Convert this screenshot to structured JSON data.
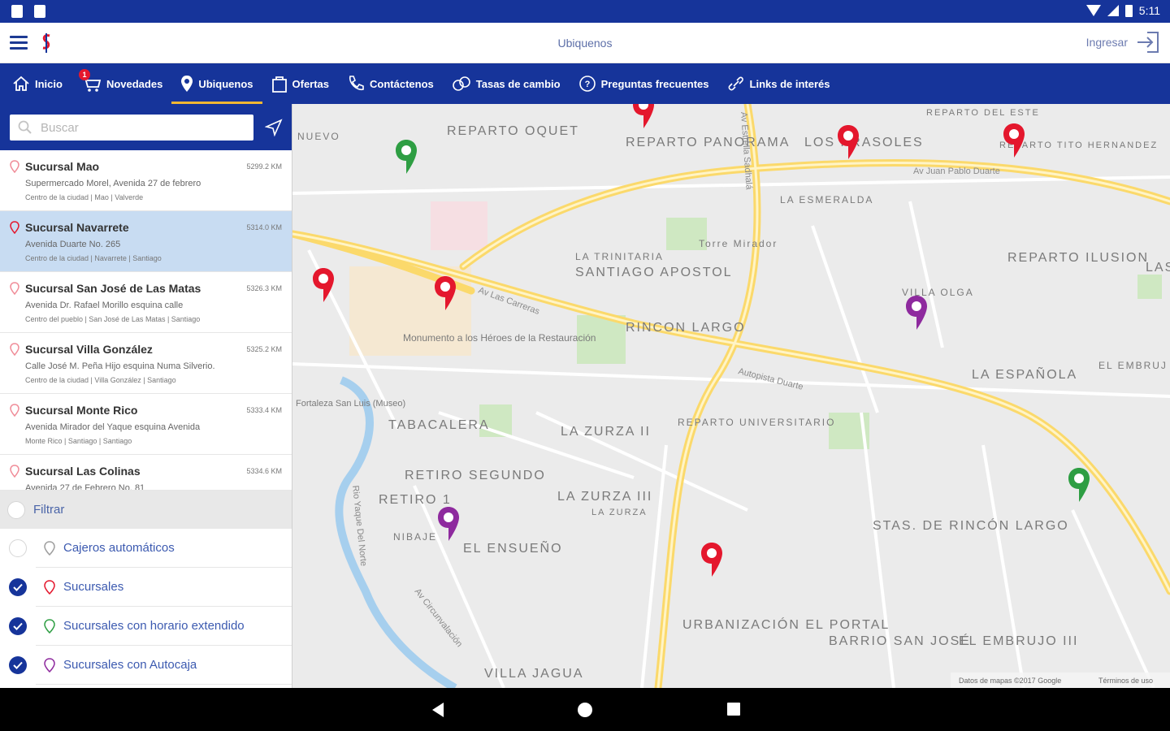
{
  "status_bar": {
    "time": "5:11"
  },
  "app_bar": {
    "title": "Ubiquenos",
    "login_label": "Ingresar"
  },
  "nav": {
    "tabs": [
      {
        "label": "Inicio",
        "icon": "home-icon"
      },
      {
        "label": "Novedades",
        "icon": "cart-icon",
        "badge": "1"
      },
      {
        "label": "Ubiquenos",
        "icon": "location-pin-icon",
        "active": true
      },
      {
        "label": "Ofertas",
        "icon": "offers-bag-icon"
      },
      {
        "label": "Contáctenos",
        "icon": "phone-icon"
      },
      {
        "label": "Tasas de cambio",
        "icon": "exchange-icon"
      },
      {
        "label": "Preguntas frecuentes",
        "icon": "question-icon"
      },
      {
        "label": "Links de interés",
        "icon": "link-icon"
      }
    ]
  },
  "search": {
    "placeholder": "Buscar"
  },
  "branches": [
    {
      "name": "Sucursal Mao",
      "distance": "5299.2 KM",
      "address": "Supermercado Morel, Avenida 27 de febrero",
      "zone": "Centro de la ciudad | Mao | Valverde"
    },
    {
      "name": "Sucursal Navarrete",
      "distance": "5314.0 KM",
      "address": "Avenida Duarte No. 265",
      "zone": "Centro de la ciudad | Navarrete | Santiago"
    },
    {
      "name": "Sucursal San José de Las Matas",
      "distance": "5326.3 KM",
      "address": "Avenida Dr. Rafael Morillo esquina calle",
      "zone": "Centro del pueblo | San José de Las Matas | Santiago"
    },
    {
      "name": "Sucursal Villa González",
      "distance": "5325.2 KM",
      "address": "Calle José M. Peña Hijo esquina Numa Silverio.",
      "zone": "Centro de la ciudad | Villa González | Santiago"
    },
    {
      "name": "Sucursal Monte Rico",
      "distance": "5333.4 KM",
      "address": "Avenida Mirador del Yaque esquina Avenida",
      "zone": "Monte Rico | Santiago | Santiago"
    },
    {
      "name": "Sucursal Las Colinas",
      "distance": "5334.6 KM",
      "address": "Avenida 27 de Febrero No. 81",
      "zone": ""
    }
  ],
  "filter": {
    "title": "Filtrar",
    "options": [
      {
        "label": "Cajeros automáticos",
        "checked": false,
        "pin_color": "#9e9e9e"
      },
      {
        "label": "Sucursales",
        "checked": true,
        "pin_color": "#e4172d"
      },
      {
        "label": "Sucursales con horario extendido",
        "checked": true,
        "pin_color": "#2e9e43"
      },
      {
        "label": "Sucursales con Autocaja",
        "checked": true,
        "pin_color": "#8e2a9e"
      }
    ]
  },
  "map": {
    "labels": [
      "REPARTO OQUET",
      "REPARTO PANORAMA",
      "LOS PRASOLES",
      "REPARTO DEL ESTE",
      "REPARTO TITO HERNANDEZ",
      "NUEVO",
      "LA ESMERALDA",
      "Torre Mirador",
      "LA TRINITARIA",
      "SANTIAGO APOSTOL",
      "REPARTO ILUSION",
      "LAS",
      "VILLA OLGA",
      "RINCON LARGO",
      "LA ESPAÑOLA",
      "EL EMBRUJ",
      "Monumento a los Héroes de la Restauración",
      "Fortaleza San Luis (Museo)",
      "TABACALERA",
      "LA ZURZA II",
      "REPARTO UNIVERSITARIO",
      "RETIRO SEGUNDO",
      "RETIRO 1",
      "NIBAJE",
      "EL ENSUEÑO",
      "LA ZURZA III",
      "LA ZURZA",
      "STAS. DE RINCÓN LARGO",
      "URBANIZACIÓN EL PORTAL",
      "BARRIO SAN JOSÉ",
      "EL EMBRUJO III",
      "VILLA JAGUA",
      "Av Las Carreras",
      "Autopista Duarte",
      "Av Juan Pablo Duarte",
      "Av Estrella Sadhalá",
      "Rio Yaque Del Norte",
      "Av Circunvalación"
    ],
    "attribution": "Datos de mapas ©2017 Google",
    "terms": "Términos de uso"
  },
  "colors": {
    "primary": "#16349a",
    "accent": "#f2b733",
    "selected_row": "#c8dcf2"
  }
}
